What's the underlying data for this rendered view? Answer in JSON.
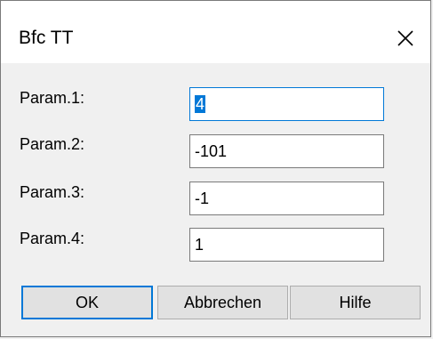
{
  "window": {
    "title": "Bfc TT"
  },
  "params": [
    {
      "label": "Param.1:",
      "value": "4",
      "focused": true
    },
    {
      "label": "Param.2:",
      "value": "-101",
      "focused": false
    },
    {
      "label": "Param.3:",
      "value": "-1",
      "focused": false
    },
    {
      "label": "Param.4:",
      "value": "1",
      "focused": false
    }
  ],
  "buttons": {
    "ok_label": "OK",
    "cancel_label": "Abbrechen",
    "help_label": "Hilfe"
  },
  "colors": {
    "accent": "#0078d7",
    "dialog_background": "#f0f0f0",
    "titlebar_background": "#ffffff"
  },
  "icons": {
    "close": "close-icon"
  }
}
